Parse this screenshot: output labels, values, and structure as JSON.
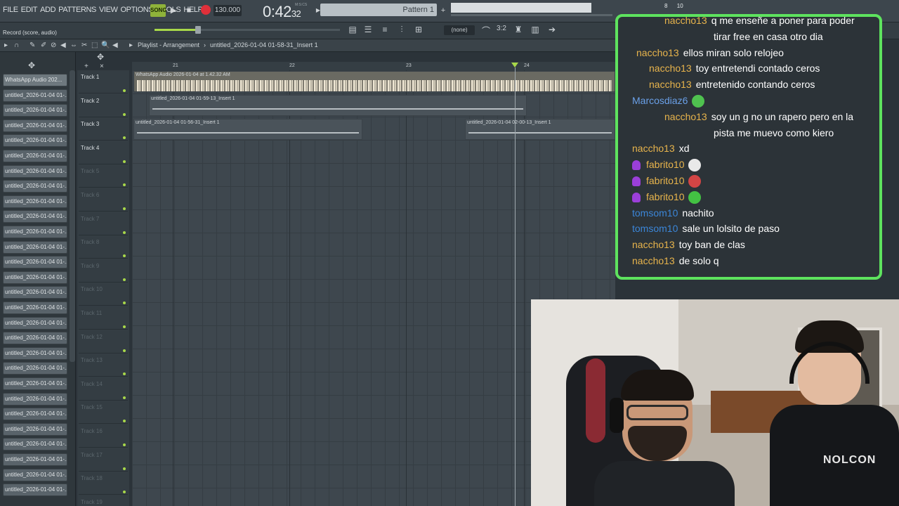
{
  "menu": [
    "FILE",
    "EDIT",
    "ADD",
    "PATTERNS",
    "VIEW",
    "OPTIONS",
    "TOOLS",
    "HELP"
  ],
  "transport": {
    "song_label": "SONG",
    "tempo": "130.000",
    "time_main": "0:42",
    "time_sub": "32",
    "time_unit": "M:S:CS",
    "pattern": "Pattern 1",
    "cpu_a": "8",
    "cpu_b": "10"
  },
  "record_label": "Record  (score, audio)",
  "snap_value": "(none)",
  "playlist": {
    "title": "Playlist - Arrangement",
    "arrow": "›",
    "clip_name": "untitled_2026-01-04 01-58-31_Insert 1"
  },
  "ruler": [
    "21",
    "22",
    "23",
    "24"
  ],
  "browser_items": [
    "WhatsApp Audio 202...",
    "untitled_2026-01-04 01-...",
    "untitled_2026-01-04 01-...",
    "untitled_2026-01-04 01-...",
    "untitled_2026-01-04 01-...",
    "untitled_2026-01-04 01-...",
    "untitled_2026-01-04 01-...",
    "untitled_2026-01-04 01-...",
    "untitled_2026-01-04 01-...",
    "untitled_2026-01-04 01-...",
    "untitled_2026-01-04 01-...",
    "untitled_2026-01-04 01-...",
    "untitled_2026-01-04 01-...",
    "untitled_2026-01-04 01-...",
    "untitled_2026-01-04 01-...",
    "untitled_2026-01-04 01-...",
    "untitled_2026-01-04 01-...",
    "untitled_2026-01-04 01-...",
    "untitled_2026-01-04 01-...",
    "untitled_2026-01-04 01-...",
    "untitled_2026-01-04 01-...",
    "untitled_2026-01-04 01-...",
    "untitled_2026-01-04 01-...",
    "untitled_2026-01-04 01-...",
    "untitled_2026-01-04 01-...",
    "untitled_2026-01-04 01-...",
    "untitled_2026-01-04 01-...",
    "untitled_2026-01-04 01-..."
  ],
  "tracks": [
    "Track 1",
    "Track 2",
    "Track 3",
    "Track 4",
    "Track 5",
    "Track 6",
    "Track 7",
    "Track 8",
    "Track 9",
    "Track 10",
    "Track 11",
    "Track 12",
    "Track 13",
    "Track 14",
    "Track 15",
    "Track 16",
    "Track 17",
    "Track 18",
    "Track 19"
  ],
  "clips": {
    "whatsapp": "WhatsApp Audio 2026-01-04 at 1.42.32 AM",
    "insert_0159": "untitled_2026-01-04 01-59-13_Insert 1",
    "insert_0156": "untitled_2026-01-04 01-56-31_Insert 1",
    "insert_0200": "untitled_2026-01-04 02-00-13_Insert 1"
  },
  "chat": [
    {
      "user": "naccho13",
      "text": "q me enseñe a poner para poder",
      "color": "#e8b44c"
    },
    {
      "user": "",
      "text": "tirar free en casa otro dia",
      "color": "#e8b44c"
    },
    {
      "user": "naccho13",
      "text": "ellos miran solo relojeo",
      "color": "#e8b44c"
    },
    {
      "user": "naccho13",
      "text": "toy entretendi contado ceros",
      "color": "#e8b44c"
    },
    {
      "user": "naccho13",
      "text": "entretenido contando ceros",
      "color": "#e8b44c"
    },
    {
      "user": "Marcosdiaz6",
      "text": "",
      "color": "#6aa0e8"
    },
    {
      "user": "naccho13",
      "text": "soy un g no un rapero pero en la",
      "color": "#e8b44c"
    },
    {
      "user": "",
      "text": "pista me muevo como kiero",
      "color": "#e8b44c"
    },
    {
      "user": "naccho13",
      "text": "xd",
      "color": "#e8b44c"
    },
    {
      "user": "fabrito10",
      "text": "",
      "color": "#e8b44c"
    },
    {
      "user": "fabrito10",
      "text": "",
      "color": "#e8b44c"
    },
    {
      "user": "fabrito10",
      "text": "",
      "color": "#e8b44c"
    },
    {
      "user": "tomsom10",
      "text": "nachito",
      "color": "#3b86d8"
    },
    {
      "user": "tomsom10",
      "text": "sale un lolsito de paso",
      "color": "#3b86d8"
    },
    {
      "user": "naccho13",
      "text": "toy ban de clas",
      "color": "#e8b44c"
    },
    {
      "user": "naccho13",
      "text": "de solo q",
      "color": "#e8b44c"
    }
  ],
  "webcam": {
    "shirt_logo": "NOLCON"
  },
  "colors": {
    "accent": "#a8d84a",
    "chat_border": "#5ee35e",
    "record": "#e0303a"
  }
}
